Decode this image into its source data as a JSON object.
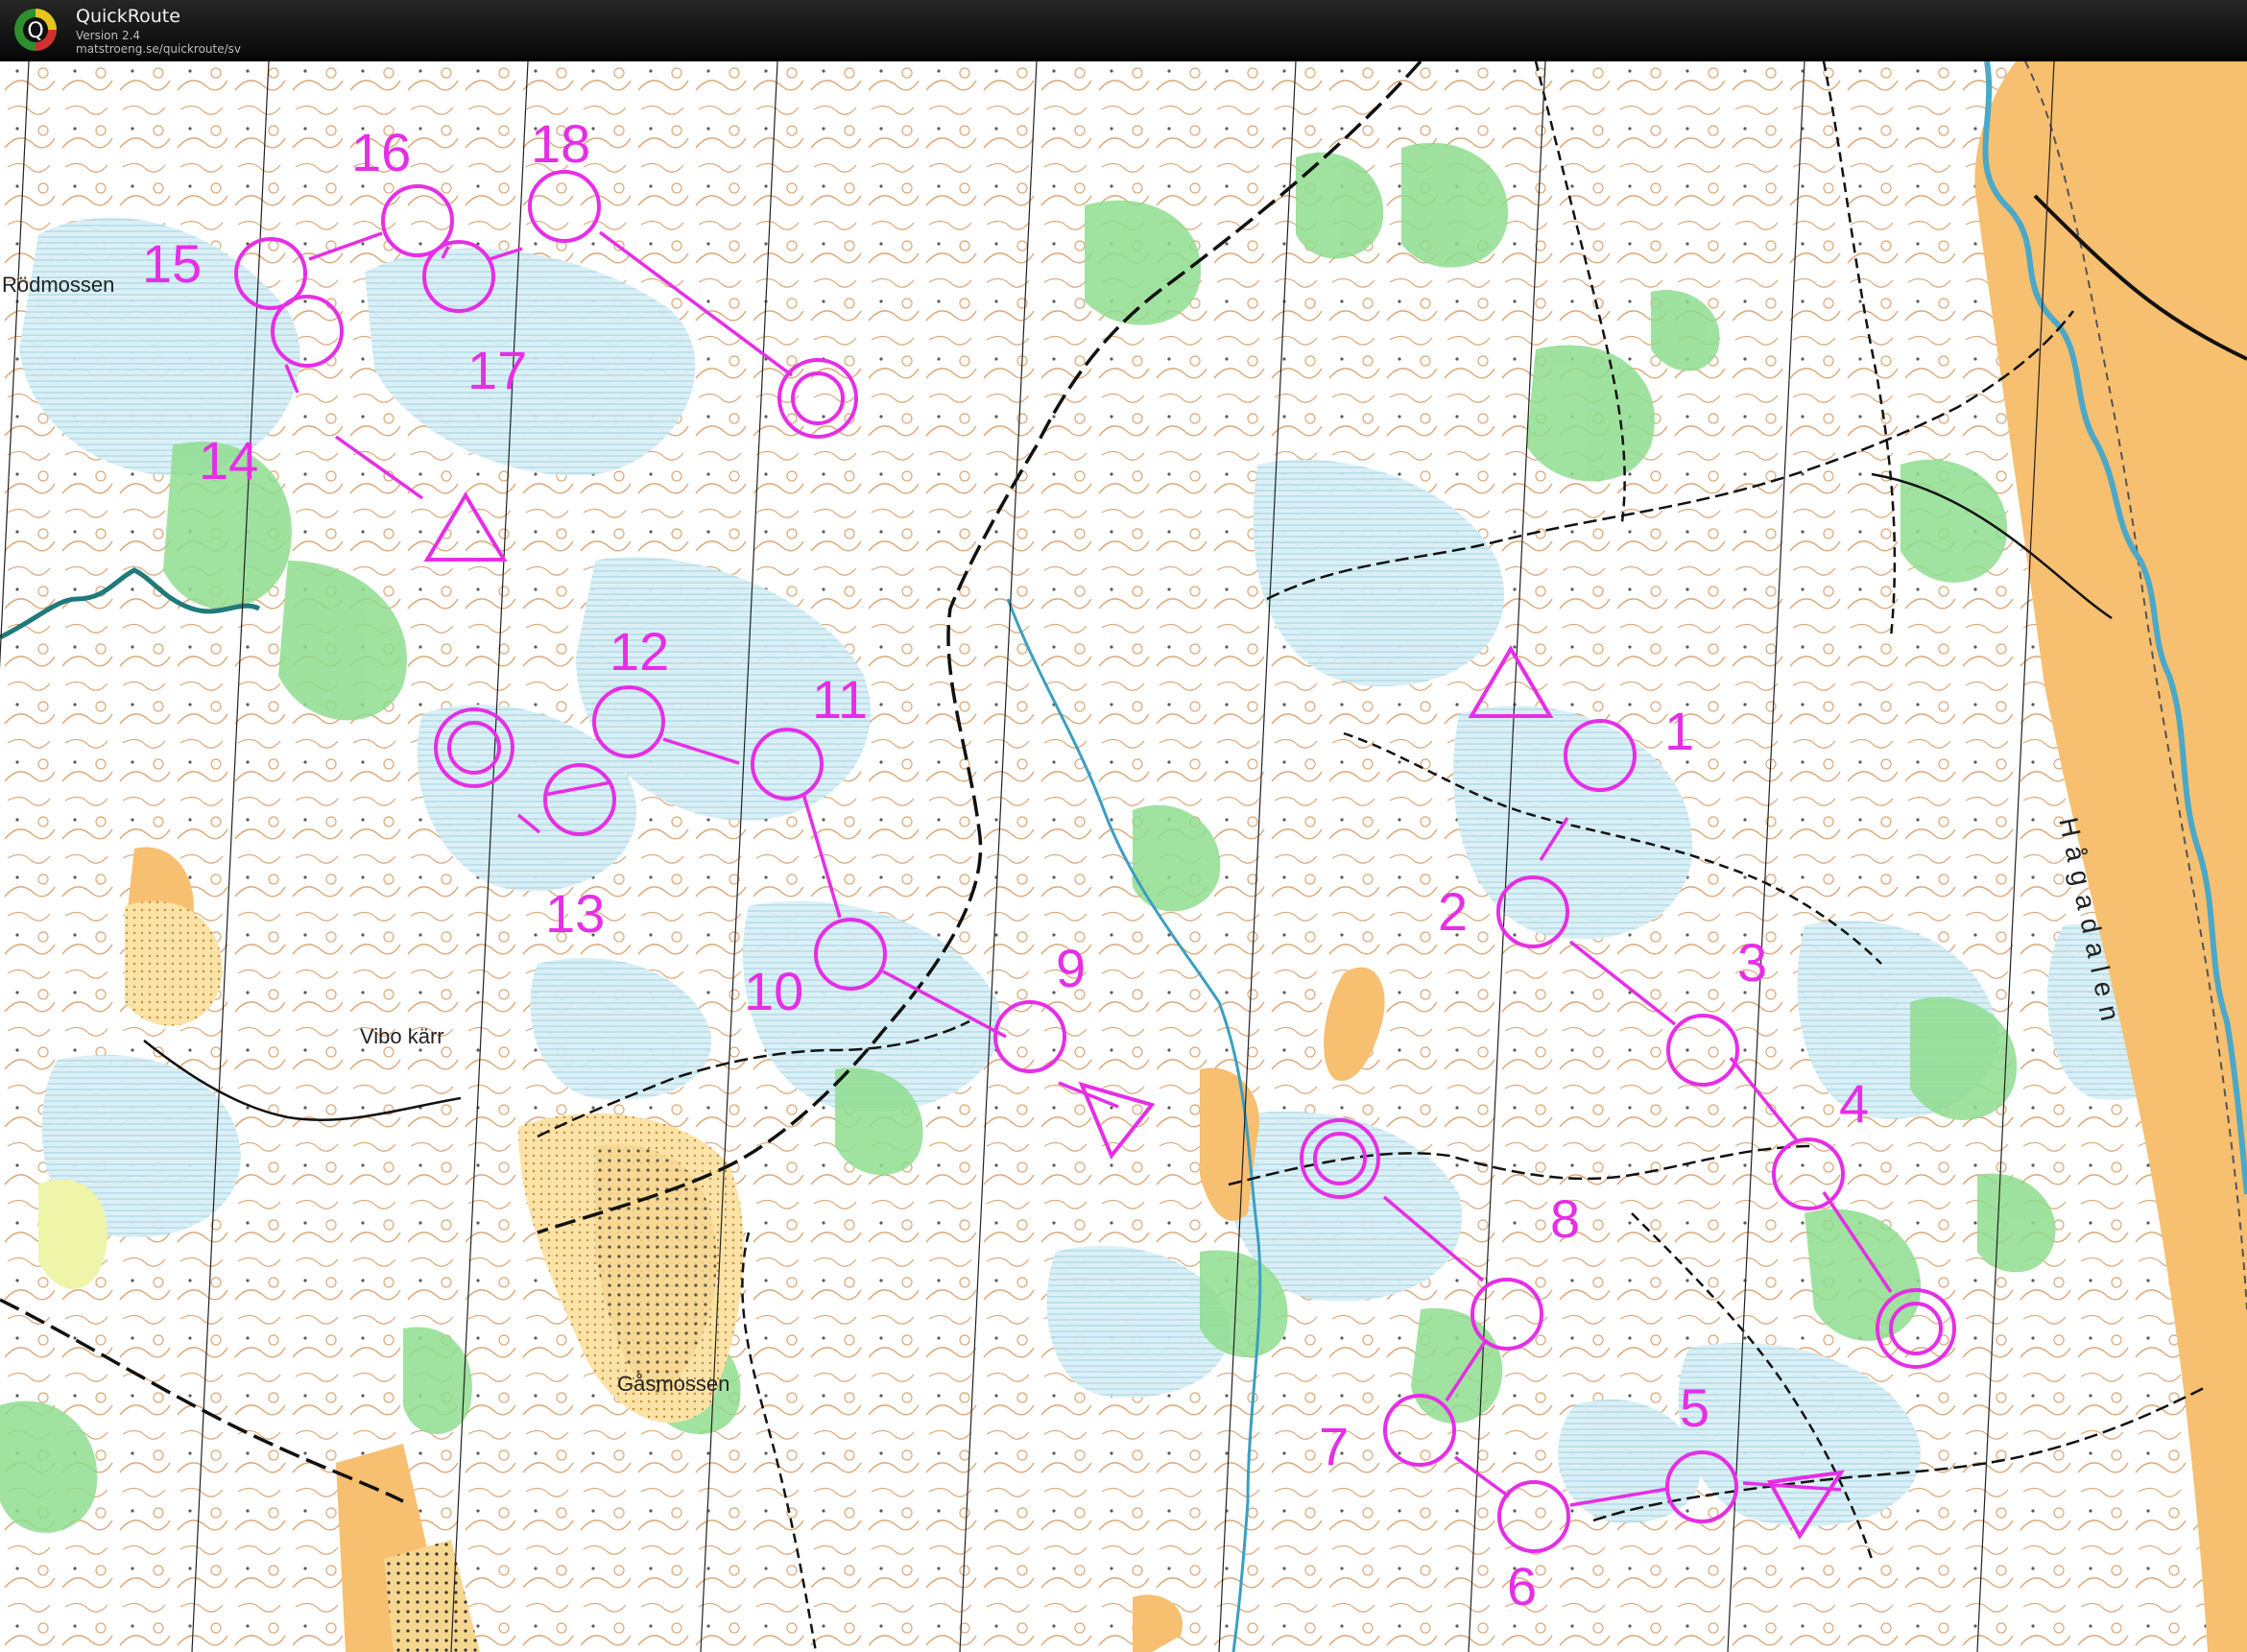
{
  "app": {
    "title": "QuickRoute",
    "version": "Version 2.4",
    "url": "matstroeng.se/quickroute/sv",
    "logo_letter": "Q"
  },
  "colors": {
    "course": "#e62ee6",
    "forest": "#ffffff",
    "marsh": "#d2ecf2",
    "green": "#8fdd8f",
    "open": "#f7bf70",
    "water": "#4aa8c8",
    "contour": "#c88040"
  },
  "map": {
    "place_names": [
      "Rödmossen",
      "Vibo kärr",
      "Gåsmossen",
      "Hågadalen"
    ]
  },
  "course": {
    "start_symbols": [
      "start-triangle"
    ],
    "finish_symbols": [
      "finish-double-circle"
    ],
    "control_numbers": [
      "1",
      "2",
      "3",
      "4",
      "5",
      "6",
      "7",
      "8",
      "9",
      "10",
      "11",
      "12",
      "13",
      "14",
      "15",
      "16",
      "17",
      "18"
    ]
  }
}
